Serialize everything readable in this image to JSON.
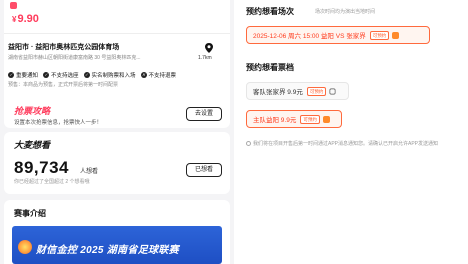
{
  "colors": {
    "accent": "#ff3b5c",
    "selected_border": "#ff6a3d",
    "banner": "#2d64d8"
  },
  "left": {
    "price": {
      "currency": "¥",
      "value": "9.90"
    },
    "venue": {
      "name": "益阳市 · 益阳市奥林匹克公园体育场",
      "address": "湖南省益阳市赫山区朝阳街道康富南路 30 号益阳奥林匹克...",
      "distance": "1.7km",
      "pin_icon": "location-pin-icon"
    },
    "policies": [
      {
        "icon": "check-icon",
        "label": "重要通知"
      },
      {
        "icon": "check-icon",
        "label": "不支持选座"
      },
      {
        "icon": "check-icon",
        "label": "实名制购票和入场"
      },
      {
        "icon": "cross-icon",
        "label": "不支持退票"
      }
    ],
    "notice": "预售：本商品为预售，正式开票后将第一时间配票",
    "grab": {
      "title": "抢票攻略",
      "subtitle": "设置本次抢票信息，抢票快人一步！",
      "button": "去设置"
    },
    "want": {
      "title": "大麦想看",
      "count": "89,734",
      "unit": "人想看",
      "subtitle": "你已经超过了全国超过 2 个想看哦",
      "button": "已想看"
    },
    "intro": {
      "title": "赛事介绍",
      "banner_text": "财信金控 2025 湖南省足球联赛"
    }
  },
  "right": {
    "session": {
      "title": "预约想看场次",
      "subtitle": "场次时间均为演出当地时间",
      "options": [
        {
          "label": "2025-12-06 周六 15:00 益阳 VS 张家界",
          "badge": "可预约",
          "selected": true
        }
      ]
    },
    "tier": {
      "title": "预约想看票档",
      "options": [
        {
          "label": "客队张家界 9.9元",
          "badge": "可预约",
          "selected": false
        },
        {
          "label": "主队益阳 9.9元",
          "badge": "可预约",
          "selected": true
        }
      ]
    },
    "tip": "我们将在项目开售后第一时间通过APP消息通知您。请确认已开启允许APP发送通知"
  }
}
